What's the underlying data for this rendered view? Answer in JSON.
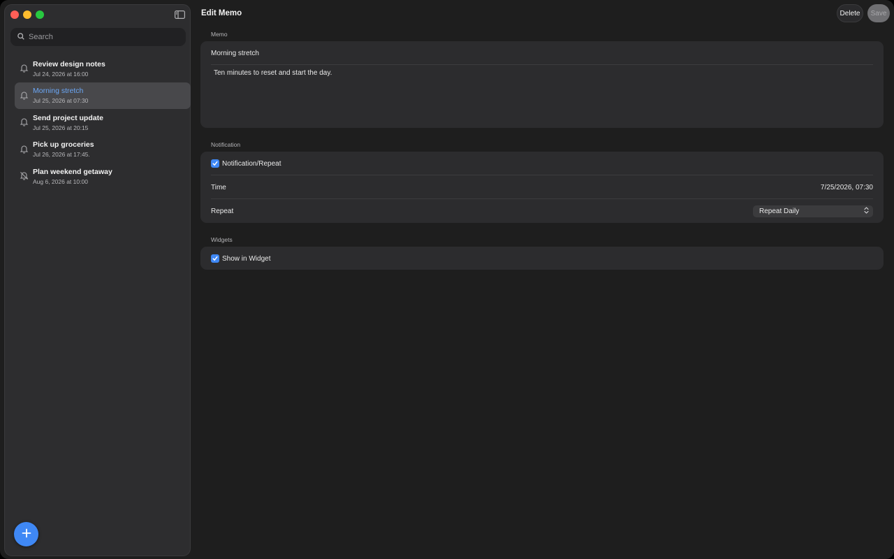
{
  "window": {
    "controls": {
      "close_color": "#ff5f57",
      "minimize_color": "#febc2e",
      "maximize_color": "#28c840"
    }
  },
  "sidebar": {
    "search": {
      "placeholder": "Search",
      "value": ""
    },
    "memos": [
      {
        "title": "Review design notes",
        "date": "Jul 24, 2026 at 16:00",
        "icon": "bell-icon",
        "selected": false
      },
      {
        "title": "Morning stretch",
        "date": "Jul 25, 2026 at 07:30",
        "icon": "bell-icon",
        "selected": true
      },
      {
        "title": "Send project update",
        "date": "Jul 25, 2026 at 20:15",
        "icon": "bell-icon",
        "selected": false
      },
      {
        "title": "Pick up groceries",
        "date": "Jul 26, 2026 at 17:45.",
        "icon": "bell-icon",
        "selected": false
      },
      {
        "title": "Plan weekend getaway",
        "date": "Aug 6, 2026 at 10:00",
        "icon": "bell-slash-icon",
        "selected": false
      }
    ],
    "add_button_icon": "plus-icon"
  },
  "header": {
    "title": "Edit Memo",
    "delete_label": "Delete",
    "save_label": "Save"
  },
  "memo_section": {
    "label": "Memo",
    "title_value": "Morning stretch",
    "body_value": "Ten minutes to reset and start the day."
  },
  "notification_section": {
    "label": "Notification",
    "toggle_label": "Notification/Repeat",
    "toggle_checked": true,
    "time_label": "Time",
    "time_value": "7/25/2026, 07:30",
    "repeat_label": "Repeat",
    "repeat_value": "Repeat Daily"
  },
  "widgets_section": {
    "label": "Widgets",
    "toggle_label": "Show in Widget",
    "toggle_checked": true
  },
  "colors": {
    "accent": "#3f88f5",
    "selected_title": "#6ba7f6"
  }
}
